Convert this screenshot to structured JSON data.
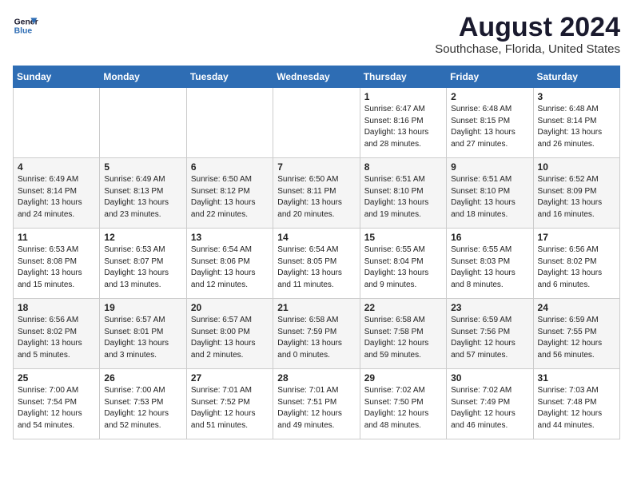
{
  "header": {
    "logo": {
      "line1": "General",
      "line2": "Blue"
    },
    "title": "August 2024",
    "subtitle": "Southchase, Florida, United States"
  },
  "calendar": {
    "days_of_week": [
      "Sunday",
      "Monday",
      "Tuesday",
      "Wednesday",
      "Thursday",
      "Friday",
      "Saturday"
    ],
    "weeks": [
      [
        {
          "day": "",
          "info": ""
        },
        {
          "day": "",
          "info": ""
        },
        {
          "day": "",
          "info": ""
        },
        {
          "day": "",
          "info": ""
        },
        {
          "day": "1",
          "info": "Sunrise: 6:47 AM\nSunset: 8:16 PM\nDaylight: 13 hours\nand 28 minutes."
        },
        {
          "day": "2",
          "info": "Sunrise: 6:48 AM\nSunset: 8:15 PM\nDaylight: 13 hours\nand 27 minutes."
        },
        {
          "day": "3",
          "info": "Sunrise: 6:48 AM\nSunset: 8:14 PM\nDaylight: 13 hours\nand 26 minutes."
        }
      ],
      [
        {
          "day": "4",
          "info": "Sunrise: 6:49 AM\nSunset: 8:14 PM\nDaylight: 13 hours\nand 24 minutes."
        },
        {
          "day": "5",
          "info": "Sunrise: 6:49 AM\nSunset: 8:13 PM\nDaylight: 13 hours\nand 23 minutes."
        },
        {
          "day": "6",
          "info": "Sunrise: 6:50 AM\nSunset: 8:12 PM\nDaylight: 13 hours\nand 22 minutes."
        },
        {
          "day": "7",
          "info": "Sunrise: 6:50 AM\nSunset: 8:11 PM\nDaylight: 13 hours\nand 20 minutes."
        },
        {
          "day": "8",
          "info": "Sunrise: 6:51 AM\nSunset: 8:10 PM\nDaylight: 13 hours\nand 19 minutes."
        },
        {
          "day": "9",
          "info": "Sunrise: 6:51 AM\nSunset: 8:10 PM\nDaylight: 13 hours\nand 18 minutes."
        },
        {
          "day": "10",
          "info": "Sunrise: 6:52 AM\nSunset: 8:09 PM\nDaylight: 13 hours\nand 16 minutes."
        }
      ],
      [
        {
          "day": "11",
          "info": "Sunrise: 6:53 AM\nSunset: 8:08 PM\nDaylight: 13 hours\nand 15 minutes."
        },
        {
          "day": "12",
          "info": "Sunrise: 6:53 AM\nSunset: 8:07 PM\nDaylight: 13 hours\nand 13 minutes."
        },
        {
          "day": "13",
          "info": "Sunrise: 6:54 AM\nSunset: 8:06 PM\nDaylight: 13 hours\nand 12 minutes."
        },
        {
          "day": "14",
          "info": "Sunrise: 6:54 AM\nSunset: 8:05 PM\nDaylight: 13 hours\nand 11 minutes."
        },
        {
          "day": "15",
          "info": "Sunrise: 6:55 AM\nSunset: 8:04 PM\nDaylight: 13 hours\nand 9 minutes."
        },
        {
          "day": "16",
          "info": "Sunrise: 6:55 AM\nSunset: 8:03 PM\nDaylight: 13 hours\nand 8 minutes."
        },
        {
          "day": "17",
          "info": "Sunrise: 6:56 AM\nSunset: 8:02 PM\nDaylight: 13 hours\nand 6 minutes."
        }
      ],
      [
        {
          "day": "18",
          "info": "Sunrise: 6:56 AM\nSunset: 8:02 PM\nDaylight: 13 hours\nand 5 minutes."
        },
        {
          "day": "19",
          "info": "Sunrise: 6:57 AM\nSunset: 8:01 PM\nDaylight: 13 hours\nand 3 minutes."
        },
        {
          "day": "20",
          "info": "Sunrise: 6:57 AM\nSunset: 8:00 PM\nDaylight: 13 hours\nand 2 minutes."
        },
        {
          "day": "21",
          "info": "Sunrise: 6:58 AM\nSunset: 7:59 PM\nDaylight: 13 hours\nand 0 minutes."
        },
        {
          "day": "22",
          "info": "Sunrise: 6:58 AM\nSunset: 7:58 PM\nDaylight: 12 hours\nand 59 minutes."
        },
        {
          "day": "23",
          "info": "Sunrise: 6:59 AM\nSunset: 7:56 PM\nDaylight: 12 hours\nand 57 minutes."
        },
        {
          "day": "24",
          "info": "Sunrise: 6:59 AM\nSunset: 7:55 PM\nDaylight: 12 hours\nand 56 minutes."
        }
      ],
      [
        {
          "day": "25",
          "info": "Sunrise: 7:00 AM\nSunset: 7:54 PM\nDaylight: 12 hours\nand 54 minutes."
        },
        {
          "day": "26",
          "info": "Sunrise: 7:00 AM\nSunset: 7:53 PM\nDaylight: 12 hours\nand 52 minutes."
        },
        {
          "day": "27",
          "info": "Sunrise: 7:01 AM\nSunset: 7:52 PM\nDaylight: 12 hours\nand 51 minutes."
        },
        {
          "day": "28",
          "info": "Sunrise: 7:01 AM\nSunset: 7:51 PM\nDaylight: 12 hours\nand 49 minutes."
        },
        {
          "day": "29",
          "info": "Sunrise: 7:02 AM\nSunset: 7:50 PM\nDaylight: 12 hours\nand 48 minutes."
        },
        {
          "day": "30",
          "info": "Sunrise: 7:02 AM\nSunset: 7:49 PM\nDaylight: 12 hours\nand 46 minutes."
        },
        {
          "day": "31",
          "info": "Sunrise: 7:03 AM\nSunset: 7:48 PM\nDaylight: 12 hours\nand 44 minutes."
        }
      ]
    ]
  }
}
